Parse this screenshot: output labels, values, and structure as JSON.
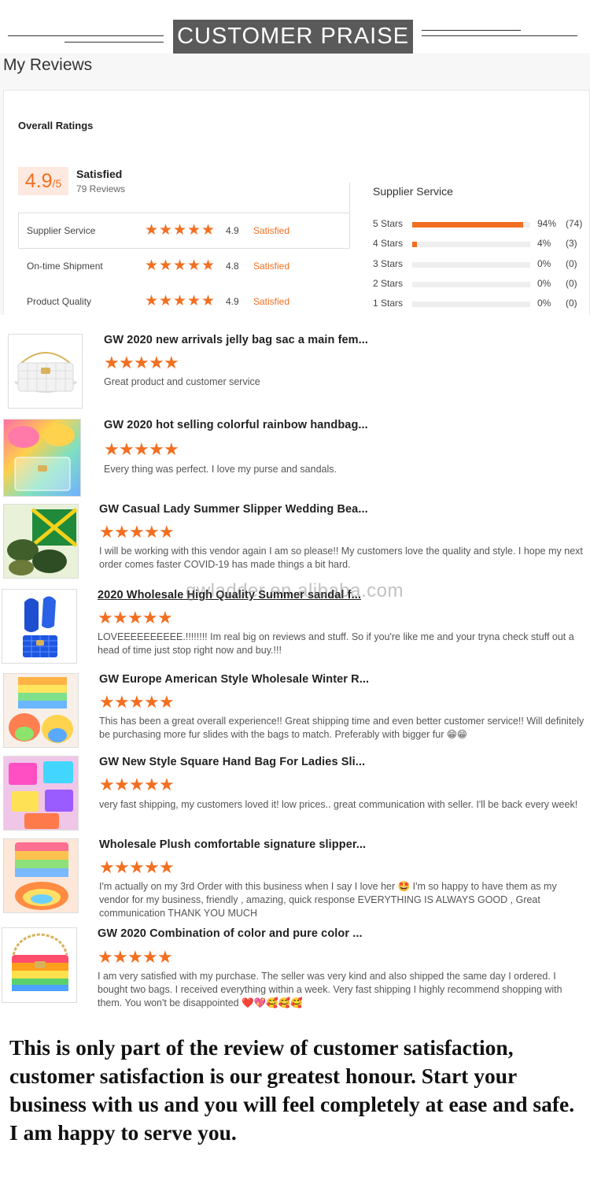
{
  "header": {
    "banner_title": "CUSTOMER PRAISE"
  },
  "reviews_panel": {
    "title": "My Reviews",
    "overall_label": "Overall Ratings",
    "score": "4.9",
    "score_suffix": "/5",
    "satisfied": "Satisfied",
    "reviews_count": "79 Reviews",
    "ratings": [
      {
        "label": "Supplier Service",
        "score": "4.9",
        "status": "Satisfied"
      },
      {
        "label": "On-time Shipment",
        "score": "4.8",
        "status": "Satisfied"
      },
      {
        "label": "Product Quality",
        "score": "4.9",
        "status": "Satisfied"
      }
    ],
    "supplier_service_title": "Supplier Service",
    "distribution": [
      {
        "label": "5 Stars",
        "percent_value": 94,
        "percent": "94%",
        "count": "(74)"
      },
      {
        "label": "4 Stars",
        "percent_value": 4,
        "percent": "4%",
        "count": "(3)"
      },
      {
        "label": "3 Stars",
        "percent_value": 0,
        "percent": "0%",
        "count": "(0)"
      },
      {
        "label": "2 Stars",
        "percent_value": 0,
        "percent": "0%",
        "count": "(0)"
      },
      {
        "label": "1 Stars",
        "percent_value": 0,
        "percent": "0%",
        "count": "(0)"
      }
    ],
    "star_rating_value": 5
  },
  "reviews": [
    {
      "title": "GW 2020 new arrivals jelly bag sac a main fem...",
      "text": "Great product and customer service",
      "image": "white-quilted-jelly-bag"
    },
    {
      "title": "GW 2020 hot selling colorful rainbow handbag...",
      "text": "Every thing was perfect. I love my purse and sandals.",
      "image": "rainbow-handbag-and-fur-slides"
    },
    {
      "title": "GW Casual Lady Summer Slipper Wedding Bea...",
      "text": "I will be working with this vendor again I am so please!! My customers love the quality and style. I hope my next order comes faster COVID-19 has made things a bit hard.",
      "image": "green-yellow-fur-slippers"
    },
    {
      "title": "2020 Wholesale High Quality Summer sandal f...",
      "text": "LOVEEEEEEEEEE.!!!!!!!! Im real big on reviews and stuff. So if you're like me and your tryna check stuff out a head of time just stop right now and buy.!!!",
      "image": "blue-sandals-and-blue-bag"
    },
    {
      "title": "GW Europe American Style Wholesale Winter R...",
      "text": "This has been a great overall experience!! Great shipping time and even better customer service!! Will definitely be purchasing more fur slides with the bags to match. Preferably with bigger fur 😁😁",
      "image": "rainbow-bag-and-rainbow-fur-slides"
    },
    {
      "title": "GW New Style Square Hand Bag For Ladies Sli...",
      "text": "very fast shipping, my customers loved it! low prices.. great communication with seller. I'll be back every week!",
      "image": "colorful-square-bags"
    },
    {
      "title": "Wholesale Plush comfortable signature slipper...",
      "text": "I'm actually on my 3rd Order with this business when I say I love her 🤩 I'm so happy to have them as my vendor for my business, friendly , amazing, quick response EVERYTHING IS ALWAYS GOOD , Great communication THANK YOU MUCH",
      "image": "rainbow-bag-and-fur-slipper"
    },
    {
      "title": "GW 2020 Combination of color and pure color ...",
      "text": "I am very satisfied with my purchase. The seller was very kind and also shipped the same day I ordered. I bought two bags. I received everything within a week. Very fast shipping I highly recommend shopping with them. You won't be disappointed ❤️💖🥰🥰🥰",
      "image": "rainbow-chain-bag"
    }
  ],
  "watermark": "gwladder.en.alibaba.com",
  "footer_text": "This is only part of the review of customer satisfaction, customer satisfaction is our greatest honour. Start your business with us and you will feel completely at ease and safe. I am happy to serve you.",
  "colors": {
    "accent": "#f26f21",
    "banner_bg": "#5a5a5a",
    "score_bg": "#fde9df"
  }
}
